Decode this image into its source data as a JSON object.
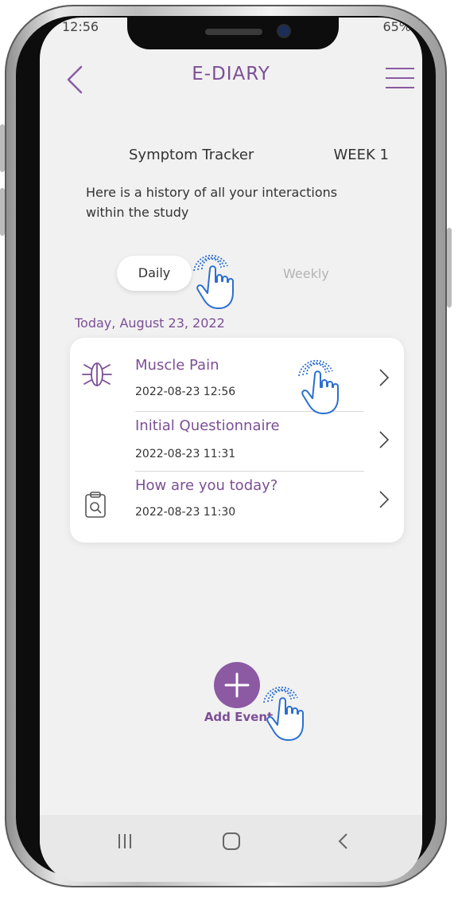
{
  "status": {
    "time": "12:56",
    "right": "65%"
  },
  "header": {
    "title": "E-DIARY"
  },
  "tracker": {
    "title": "Symptom Tracker",
    "week": "WEEK 1",
    "description": "Here is a history of all your interactions within the study"
  },
  "tabs": {
    "daily": "Daily",
    "weekly": "Weekly"
  },
  "date_label": "Today, August 23, 2022",
  "entries": [
    {
      "title": "Muscle Pain",
      "time": "2022-08-23 12:56",
      "icon": "muscle-icon"
    },
    {
      "title": "Initial Questionnaire",
      "time": "2022-08-23 11:31",
      "icon": ""
    },
    {
      "title": "How are you today?",
      "time": "2022-08-23 11:30",
      "icon": "clipboard-search-icon"
    }
  ],
  "add_event": {
    "label": "Add Event"
  },
  "colors": {
    "accent": "#7c4f96",
    "button": "#8b5aa3",
    "tap_hint": "#2b6fd1"
  }
}
